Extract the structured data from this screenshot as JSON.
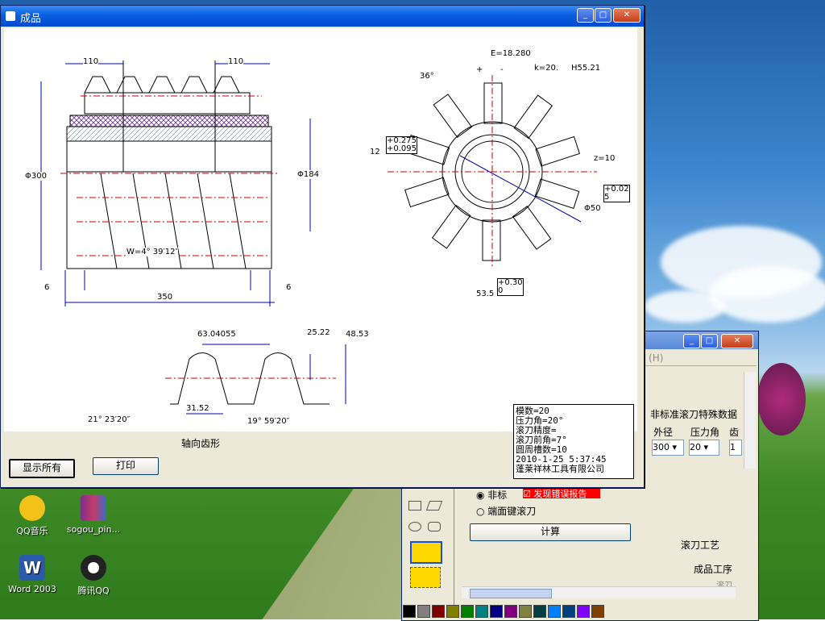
{
  "window_title": "成品",
  "drawing_labels": {
    "dim_110_left": "110",
    "dim_110_right": "110",
    "dim_phi300": "Φ300",
    "dim_phi184": "Φ184",
    "dim_w_angle": "W=4° 39′12″",
    "dim_6_left": "6",
    "dim_6_right": "6",
    "dim_350": "350",
    "dim_e": "E=18.280",
    "dim_36deg": "36°",
    "dim_plus": "+",
    "dim_minus": "-",
    "dim_k20": "k=20.",
    "dim_h55": "H55.21",
    "dim_12": "12",
    "dim_tol1a": "+0.275",
    "dim_tol1b": "+0.095",
    "dim_z10": "z=10",
    "dim_tol2a": "+0.02",
    "dim_tol2b": "5",
    "dim_phi50": "Φ50",
    "dim_53_5": "53.5",
    "dim_tol3a": "+0.30",
    "dim_tol3b": "0",
    "dim_63": "63.04055",
    "dim_25": "25.22",
    "dim_48": "48.53",
    "dim_31": "31.52",
    "dim_21deg": "21° 23′20″",
    "dim_19deg": "19° 59′20″",
    "axial_profile": "轴向齿形"
  },
  "info_box": [
    "模数=20",
    "压力角=20°",
    "滚刀精度=",
    "滚刀前角=7°",
    "圆周槽数=10",
    "2010-1-25 5:37:45",
    "蓬莱祥林工具有限公司"
  ],
  "buttons": {
    "show_all": "显示所有",
    "print": "打印"
  },
  "bg_window": {
    "menu_hint": "H",
    "nonstd_data_title": "非标准滚刀特殊数据",
    "col_outer": "外径",
    "col_pressure": "压力角",
    "col_teeth": "齿",
    "val_outer": "300",
    "val_pressure": "20",
    "val_teeth": "1",
    "radio_nonstd": "非标",
    "check_error": "发现错误报告",
    "radio_end_key": "端面键滚刀",
    "calc_button": "计算",
    "hob_process": "滚刀工艺",
    "product_process": "成品工序",
    "small_lbl": "滚刀"
  },
  "desktop_icons": [
    {
      "label": "QQ音乐",
      "color": "#f2c21b"
    },
    {
      "label": "sogou_pin...",
      "color": "#7a2f8c"
    },
    {
      "label": "Word 2003",
      "color": "#2b5aa8"
    },
    {
      "label": "腾讯QQ",
      "color": "#222222"
    }
  ],
  "colors": {
    "titlebar": "#0a5fe0",
    "dim_line": "#0000aa",
    "center_line": "#cc0000",
    "hatch_purple": "#b388c8",
    "hatch_cyan": "#bfe6ea",
    "error_red": "#ff0000"
  },
  "palette": [
    "#000000",
    "#808080",
    "#800000",
    "#808000",
    "#008000",
    "#008080",
    "#000080",
    "#800080",
    "#808040",
    "#004040",
    "#0080ff",
    "#004080",
    "#8000ff",
    "#804000"
  ]
}
